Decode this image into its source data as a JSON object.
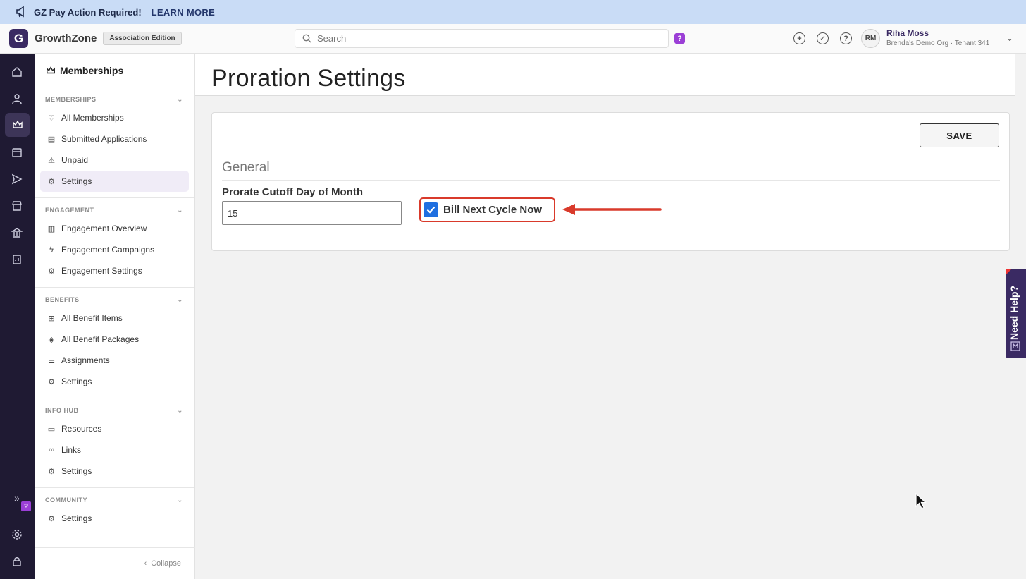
{
  "banner": {
    "message": "GZ Pay Action Required!",
    "link": "LEARN MORE",
    "icon": "megaphone-icon"
  },
  "header": {
    "logo_letter": "G",
    "brand": "GrowthZone",
    "edition": "Association Edition",
    "search_placeholder": "Search",
    "help_badge": "?",
    "user_initials": "RM",
    "user_name": "Riha Moss",
    "user_org": "Brenda's Demo Org · Tenant 341"
  },
  "rail": {
    "icons": [
      "home-icon",
      "person-icon",
      "crown-icon",
      "calendar-icon",
      "send-icon",
      "store-icon",
      "bank-icon",
      "report-icon"
    ],
    "active": "crown-icon",
    "bottom_badge": "?"
  },
  "sidebar": {
    "title": "Memberships",
    "sections": [
      {
        "title": "MEMBERSHIPS",
        "items": [
          {
            "label": "All Memberships",
            "icon": "heart-icon"
          },
          {
            "label": "Submitted Applications",
            "icon": "document-icon"
          },
          {
            "label": "Unpaid",
            "icon": "warning-icon"
          },
          {
            "label": "Settings",
            "icon": "gear-icon",
            "active": true
          }
        ]
      },
      {
        "title": "ENGAGEMENT",
        "items": [
          {
            "label": "Engagement Overview",
            "icon": "bar-chart-icon"
          },
          {
            "label": "Engagement Campaigns",
            "icon": "bolt-icon"
          },
          {
            "label": "Engagement Settings",
            "icon": "gear-icon"
          }
        ]
      },
      {
        "title": "BENEFITS",
        "items": [
          {
            "label": "All Benefit Items",
            "icon": "gift-icon"
          },
          {
            "label": "All Benefit Packages",
            "icon": "package-icon"
          },
          {
            "label": "Assignments",
            "icon": "checklist-icon"
          },
          {
            "label": "Settings",
            "icon": "gear-icon"
          }
        ]
      },
      {
        "title": "INFO HUB",
        "items": [
          {
            "label": "Resources",
            "icon": "folder-icon"
          },
          {
            "label": "Links",
            "icon": "link-icon"
          },
          {
            "label": "Settings",
            "icon": "gear-icon"
          }
        ]
      },
      {
        "title": "COMMUNITY",
        "items": [
          {
            "label": "Settings",
            "icon": "gear-icon"
          }
        ]
      }
    ],
    "collapse_label": "Collapse"
  },
  "page": {
    "title": "Proration Settings",
    "save_label": "SAVE",
    "section_title": "General",
    "cutoff_label": "Prorate Cutoff Day of Month",
    "cutoff_value": "15",
    "checkbox_label": "Bill Next Cycle Now",
    "checkbox_checked": true
  },
  "help_tab": {
    "label": "Need Help?"
  },
  "colors": {
    "accent": "#3a2a63",
    "highlight": "#d93a2b",
    "checkbox": "#1f6fe0",
    "banner": "#c9dcf6"
  }
}
